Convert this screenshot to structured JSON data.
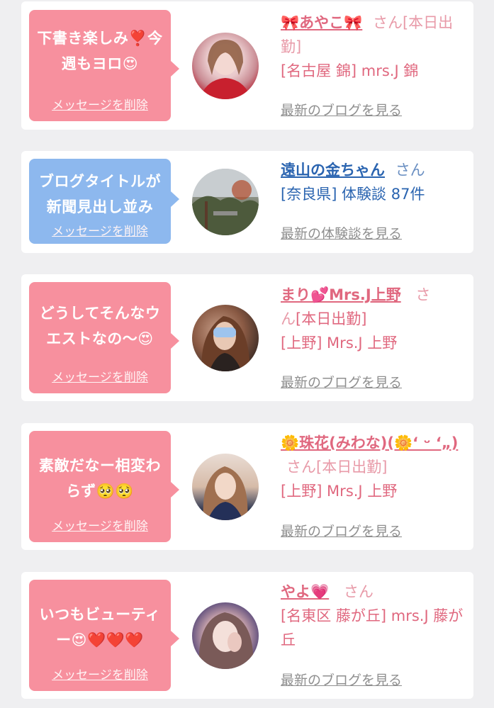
{
  "items": [
    {
      "message": "下書き楽しみ❣️今週もヨロ😍",
      "delete_label": "メッセージを削除",
      "name": "🎀あやこ🎀",
      "honorific": "さん",
      "status": "[本日出勤]",
      "location": "[名古屋 錦] mrs.J 錦",
      "more_label": "最新のブログを見る",
      "theme": "pink"
    },
    {
      "message": "ブログタイトルが新聞見出し並み",
      "delete_label": "メッセージを削除",
      "name": "遠山の金ちゃん",
      "honorific": "さん",
      "status": "",
      "location": "[奈良県] 体験談 87件",
      "more_label": "最新の体験談を見る",
      "theme": "blue"
    },
    {
      "message": "どうしてそんなウエストなの〜😍",
      "delete_label": "メッセージを削除",
      "name": "まり💕Mrs.J上野",
      "honorific": "さ",
      "honorific_rest": "ん",
      "status": "[本日出勤]",
      "location": "[上野] Mrs.J 上野",
      "more_label": "最新のブログを見る",
      "theme": "pink"
    },
    {
      "message": "素敵だなー相変わらず🥺🥺",
      "delete_label": "メッセージを削除",
      "name": "🌼珠花(みわな)(🌼‘ ᵕ ‘„)",
      "honorific": "さん",
      "status": "[本日出勤]",
      "location": "[上野] Mrs.J 上野",
      "more_label": "最新のブログを見る",
      "theme": "pink"
    },
    {
      "message": "いつもビューティー😍❤️❤️❤️",
      "delete_label": "メッセージを削除",
      "name": "やよ💗",
      "honorific": "さん",
      "status": "",
      "location": "[名東区 藤が丘] mrs.J 藤が丘",
      "more_label": "最新のブログを見る",
      "theme": "pink"
    }
  ],
  "colors": {
    "pink_bubble": "#f7909e",
    "blue_bubble": "#8db8ee",
    "pink_text": "#e0687f",
    "blue_text": "#2a64b0",
    "background": "#efeff1"
  }
}
